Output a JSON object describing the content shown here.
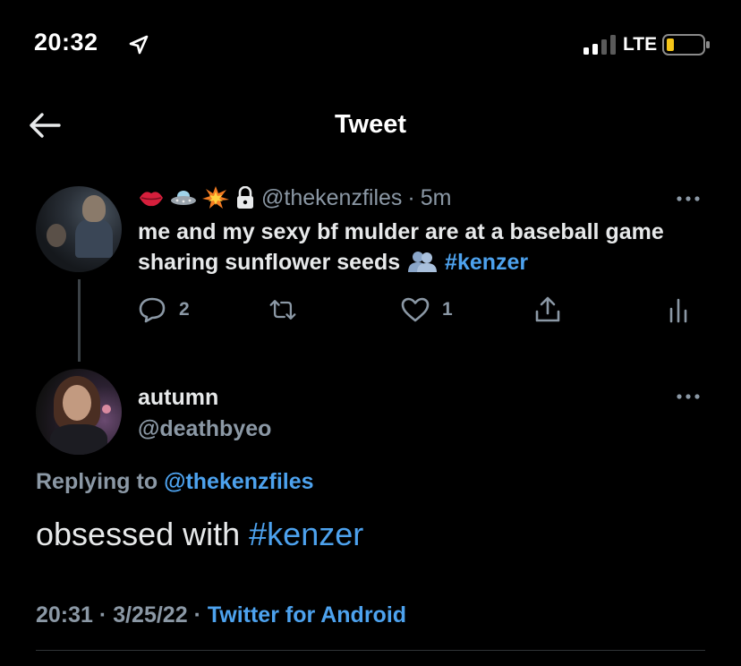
{
  "status_bar": {
    "time": "20:32",
    "network": "LTE",
    "location_icon": "location-arrow-icon",
    "signal_icon": "cellular-signal-icon",
    "battery_icon": "battery-low-icon",
    "battery_color": "#f5c518"
  },
  "header": {
    "title": "Tweet",
    "back_icon": "back-arrow-icon"
  },
  "parent_tweet": {
    "name_emojis": [
      "lips-emoji",
      "flying-saucer-emoji",
      "collision-emoji"
    ],
    "protected_icon": "lock-icon",
    "handle": "@thekenzfiles",
    "separator": "·",
    "time_ago": "5m",
    "text_before": "me and my sexy bf mulder are at a baseball game sharing sunflower seeds",
    "inline_emoji": "busts-in-silhouette-emoji",
    "hashtag": "#kenzer",
    "actions": {
      "reply_count": "2",
      "retweet_count": "",
      "like_count": "1"
    }
  },
  "reply_tweet": {
    "name": "autumn",
    "handle": "@deathbyeo",
    "replying_label": "Replying to",
    "replying_to": "@thekenzfiles",
    "text_before": "obsessed with",
    "hashtag": "#kenzer",
    "time": "20:31",
    "separator": "·",
    "date": "3/25/22",
    "separator2": "·",
    "source": "Twitter for Android"
  },
  "colors": {
    "background": "#000000",
    "text": "#e7e9ea",
    "muted": "#8b98a5",
    "accent": "#4da2ee"
  }
}
